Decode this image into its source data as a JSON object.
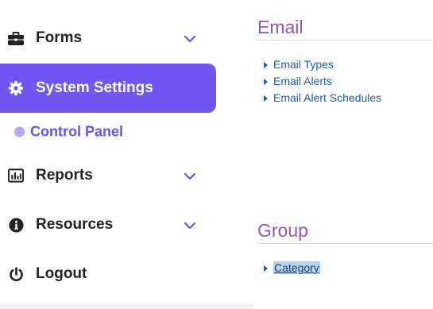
{
  "sidebar": {
    "items": [
      {
        "label": "Forms",
        "icon": "briefcase-icon",
        "has_chevron": true
      },
      {
        "label": "System Settings",
        "icon": "gear-icon",
        "active": true
      },
      {
        "label": "Reports",
        "icon": "bar-chart-icon",
        "has_chevron": true
      },
      {
        "label": "Resources",
        "icon": "info-icon",
        "has_chevron": true
      },
      {
        "label": "Logout",
        "icon": "power-icon"
      }
    ],
    "sub_items": [
      {
        "label": "Control Panel"
      }
    ]
  },
  "email_section": {
    "title": "Email",
    "links": [
      "Email Types",
      "Email Alerts",
      "Email Alert Schedules"
    ]
  },
  "group_section": {
    "title": "Group",
    "links": [
      "Category"
    ]
  },
  "colors": {
    "accent": "#7156f5",
    "sub_accent": "#6a50ee",
    "heading": "#8b59b9",
    "link": "#1f5fa0",
    "selection": "#b9d2f0"
  }
}
